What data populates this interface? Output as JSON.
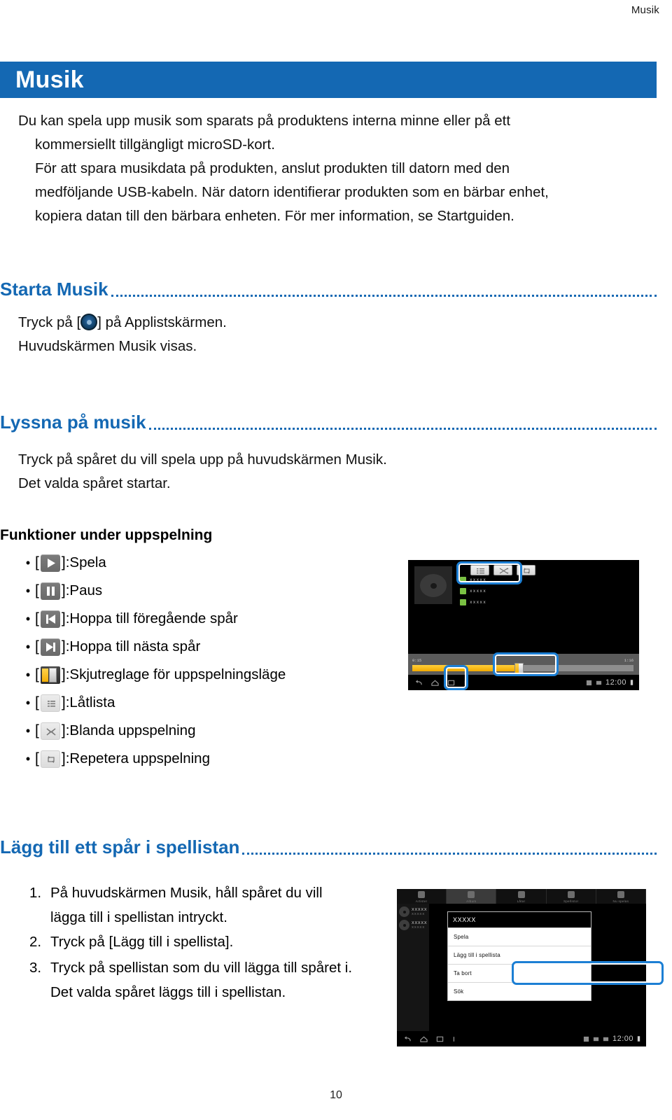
{
  "running_header": "Musik",
  "chapter": {
    "title": "Musik"
  },
  "intro": {
    "lines": [
      "Du kan spela upp musik som sparats på produktens interna minne eller på ett",
      "kommersiellt tillgängligt microSD-kort.",
      "För att spara musikdata på produkten, anslut produkten till datorn med den",
      "medföljande USB-kabeln. När datorn identifierar produkten som en bärbar enhet,",
      "kopiera datan till den bärbara enheten. För mer information, se Startguiden."
    ]
  },
  "sections": [
    {
      "heading": "Starta Musik",
      "line_prefix": "Tryck på [",
      "line_suffix": "] på Applistskärmen.",
      "icon": "music-app-icon",
      "line2": "Huvudskärmen Musik visas."
    },
    {
      "heading": "Lyssna på musik",
      "line1": "Tryck på spåret du vill spela upp på huvudskärmen Musik.",
      "line2": "Det valda spåret startar."
    },
    {
      "heading": "Lägg till ett spår i spellistan"
    }
  ],
  "functions": {
    "heading": "Funktioner under uppspelning",
    "bullet": "•",
    "bracket_open": "[",
    "bracket_close": "]",
    "separator": ": ",
    "items": [
      {
        "icon": "play-icon",
        "label": "Spela"
      },
      {
        "icon": "pause-icon",
        "label": "Paus"
      },
      {
        "icon": "previous-icon",
        "label": "Hoppa till föregående spår"
      },
      {
        "icon": "next-icon",
        "label": "Hoppa till nästa spår"
      },
      {
        "icon": "seek-slider-icon",
        "label": "Skjutreglage för uppspelningsläge"
      },
      {
        "icon": "playlist-icon",
        "label": "Låtlista"
      },
      {
        "icon": "shuffle-icon",
        "label": "Blanda uppspelning"
      },
      {
        "icon": "repeat-icon",
        "label": "Repetera uppspelning"
      }
    ]
  },
  "playlist_steps": {
    "items": [
      {
        "n": "1.",
        "text": "På huvudskärmen Musik, håll spåret du vill",
        "cont": "lägga till i spellistan intryckt."
      },
      {
        "n": "2.",
        "text": "Tryck på [Lägg till i spellista].",
        "cont": ""
      },
      {
        "n": "3.",
        "text": "Tryck på spellistan som du vill lägga till spåret i.",
        "cont": "Det valda spåret läggs till i spellistan."
      }
    ]
  },
  "player_screenshot": {
    "name": "music-player-screenshot",
    "time_elapsed": "0:15",
    "time_total": "1:16",
    "clock": "12:00",
    "meta_rows": [
      "xxxxx",
      "xxxxx",
      "xxxxx"
    ],
    "toolbar_icons": [
      "playlist-icon",
      "shuffle-icon",
      "repeat-icon"
    ],
    "transport_icons": [
      "previous-icon",
      "pause-icon",
      "next-icon"
    ]
  },
  "menu_screenshot": {
    "name": "context-menu-screenshot",
    "tabs": [
      "Artister",
      "Album",
      "Låtar",
      "Spellistor",
      "Nu spelas"
    ],
    "side_rows": [
      {
        "title": "XXXXX",
        "sub": "XXXXX"
      },
      {
        "title": "XXXXX",
        "sub": "XXXXX"
      }
    ],
    "panel_title": "XXXXX",
    "panel_items": [
      "Spela",
      "Lägg till i spellista",
      "Ta bort",
      "Sök"
    ],
    "highlighted_item": "Lägg till i spellista",
    "clock": "12:00"
  },
  "colors": {
    "accent_blue": "#1468B3",
    "highlight_blue": "#1C7FD4",
    "slider_yellow": "#F2A900",
    "meta_green": "#7AC143"
  },
  "page_number": "10"
}
